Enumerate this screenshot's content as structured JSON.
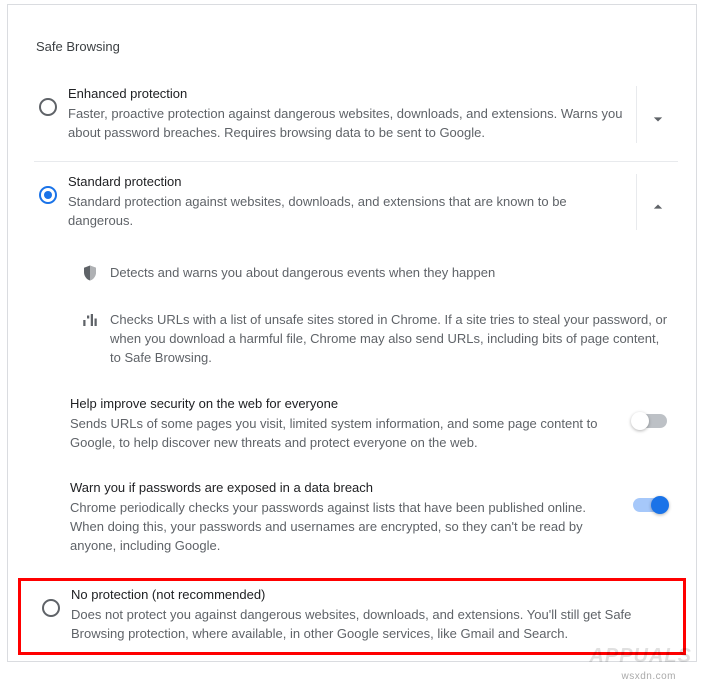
{
  "section": {
    "title": "Safe Browsing"
  },
  "options": {
    "enhanced": {
      "title": "Enhanced protection",
      "desc": "Faster, proactive protection against dangerous websites, downloads, and extensions. Warns you about password breaches. Requires browsing data to be sent to Google."
    },
    "standard": {
      "title": "Standard protection",
      "desc": "Standard protection against websites, downloads, and extensions that are known to be dangerous."
    },
    "none": {
      "title": "No protection (not recommended)",
      "desc": "Does not protect you against dangerous websites, downloads, and extensions. You'll still get Safe Browsing protection, where available, in other Google services, like Gmail and Search."
    }
  },
  "standard_details": {
    "feature1": "Detects and warns you about dangerous events when they happen",
    "feature2": "Checks URLs with a list of unsafe sites stored in Chrome. If a site tries to steal your password, or when you download a harmful file, Chrome may also send URLs, including bits of page content, to Safe Browsing.",
    "setting1": {
      "title": "Help improve security on the web for everyone",
      "desc": "Sends URLs of some pages you visit, limited system information, and some page content to Google, to help discover new threats and protect everyone on the web."
    },
    "setting2": {
      "title": "Warn you if passwords are exposed in a data breach",
      "desc": "Chrome periodically checks your passwords against lists that have been published online. When doing this, your passwords and usernames are encrypted, so they can't be read by anyone, including Google."
    }
  },
  "watermark": "wsxdn.com",
  "logo": "APPUALS"
}
